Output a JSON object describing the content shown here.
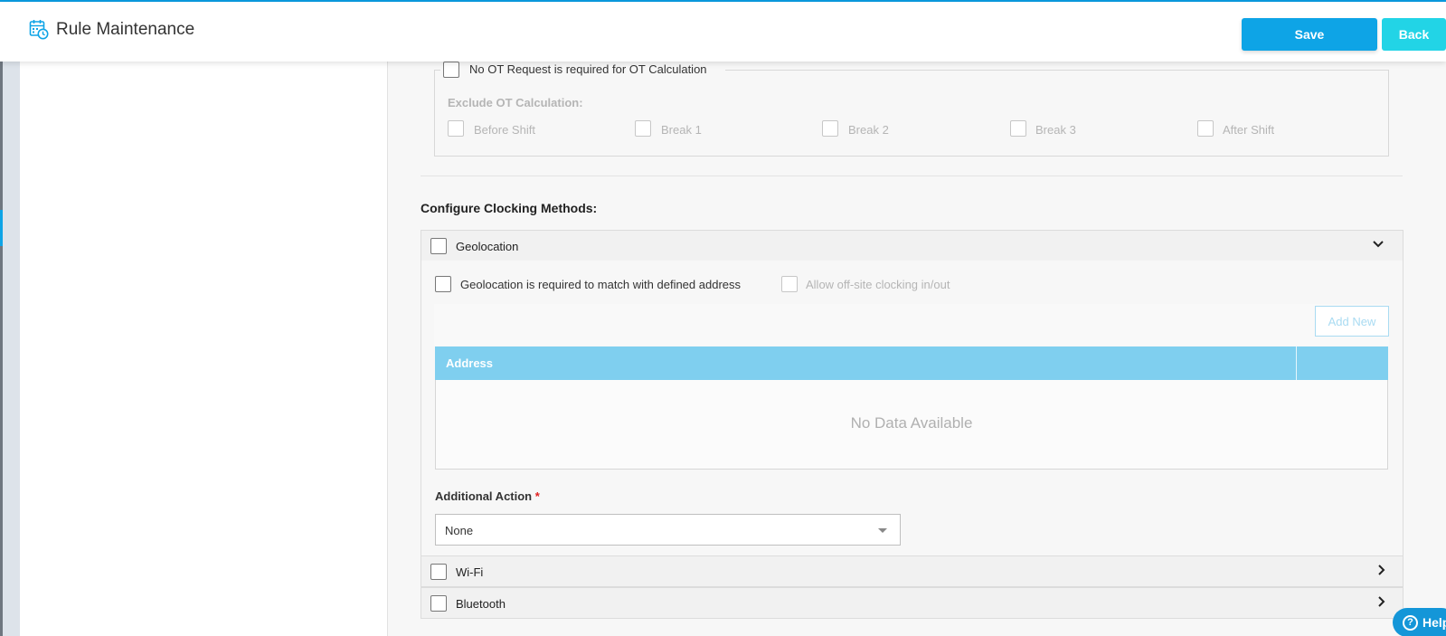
{
  "header": {
    "title": "Rule Maintenance",
    "save_label": "Save",
    "back_label": "Back",
    "icon": "calendar-clock-icon"
  },
  "ot": {
    "no_ot_request_label": "No OT Request is required for OT Calculation",
    "exclude_title": "Exclude OT Calculation:",
    "options": [
      "Before Shift",
      "Break 1",
      "Break 2",
      "Break 3",
      "After Shift"
    ]
  },
  "clocking": {
    "section_title": "Configure Clocking Methods:",
    "geolocation": {
      "label": "Geolocation",
      "match_address_label": "Geolocation is required to match with defined address",
      "offsite_label": "Allow off-site clocking in/out",
      "add_new_label": "Add New",
      "grid_header_address": "Address",
      "no_data_text": "No Data Available",
      "additional_action_label": "Additional Action",
      "required_mark": "*",
      "additional_action_value": "None"
    },
    "wifi": {
      "label": "Wi-Fi"
    },
    "bluetooth": {
      "label": "Bluetooth"
    }
  },
  "help": {
    "label": "Help",
    "glyph": "?"
  },
  "colors": {
    "primary": "#0ea4e6",
    "back": "#22d4e6",
    "grid_header": "#7fcfef",
    "required": "#e02020"
  }
}
